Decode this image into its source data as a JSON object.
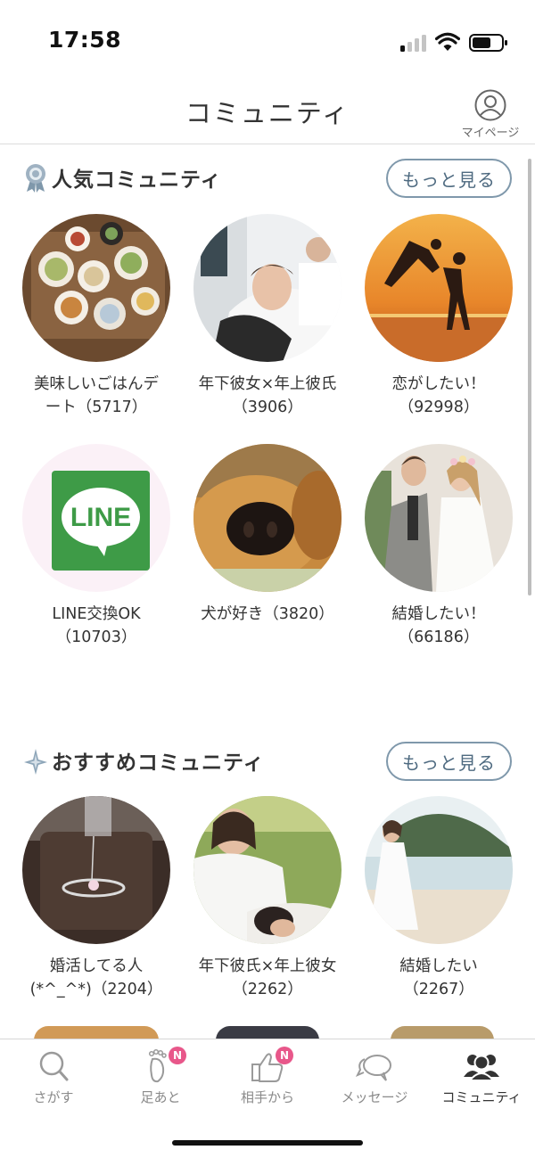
{
  "status_bar": {
    "time": "17:58"
  },
  "header": {
    "title": "コミュニティ",
    "mypage_label": "マイページ"
  },
  "popular": {
    "title": "人気コミュニティ",
    "more_label": "もっと見る",
    "items": [
      {
        "line1": "美味しいごはんデ",
        "line2": "ート（5717）"
      },
      {
        "line1": "年下彼女×年上彼氏",
        "line2": "（3906）"
      },
      {
        "line1": "恋がしたい！",
        "line2": "（92998）"
      },
      {
        "line1": "LINE交換OK",
        "line2": "（10703）"
      },
      {
        "line1": "犬が好き（3820）",
        "line2": ""
      },
      {
        "line1": "結婚したい！",
        "line2": "（66186）"
      }
    ]
  },
  "recommended": {
    "title": "おすすめコミュニティ",
    "more_label": "もっと見る",
    "items": [
      {
        "line1": "婚活してる人",
        "line2": "(*^_^*)（2204）"
      },
      {
        "line1": "年下彼氏×年上彼女",
        "line2": "（2262）"
      },
      {
        "line1": "結婚したい",
        "line2": "（2267）"
      }
    ]
  },
  "line_logo_text": "LINE",
  "bottom_nav": {
    "items": [
      {
        "label": "さがす",
        "icon": "search-icon",
        "badge": ""
      },
      {
        "label": "足あと",
        "icon": "footprint-icon",
        "badge": "N"
      },
      {
        "label": "相手から",
        "icon": "thumbs-up-icon",
        "badge": "N"
      },
      {
        "label": "メッセージ",
        "icon": "chat-bubbles-icon",
        "badge": ""
      },
      {
        "label": "コミュニティ",
        "icon": "community-icon",
        "badge": ""
      }
    ],
    "active_index": 4
  },
  "colors": {
    "accent": "#7f98ab",
    "badge": "#e8578a",
    "line_green": "#3e9b47"
  }
}
